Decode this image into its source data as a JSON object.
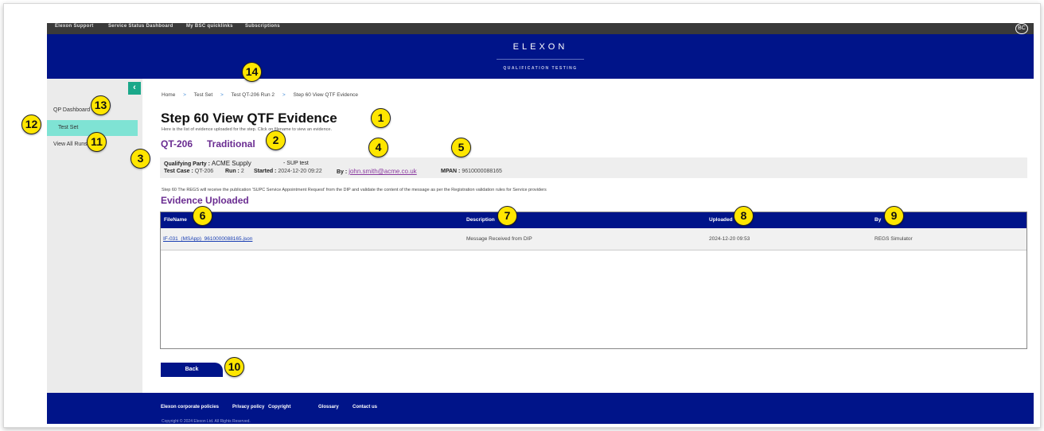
{
  "util_nav": [
    "Elexon Support",
    "Service Status Dashboard",
    "My BSC quicklinks",
    "Subscriptions"
  ],
  "user_initials": "BC",
  "header": {
    "logo": "ELEXON",
    "subtitle": "QUALIFICATION TESTING"
  },
  "sidebar": {
    "toggle_icon": "chevron-left-icon",
    "items": [
      {
        "label": "QP Dashboard",
        "active": false
      },
      {
        "label": "Test Set",
        "active": true
      },
      {
        "label": "View All Runs",
        "active": false
      }
    ]
  },
  "breadcrumb": [
    "Home",
    "Test Set",
    "Test QT-206 Run 2",
    "Step 60 View QTF Evidence"
  ],
  "page": {
    "title": "Step 60 View QTF Evidence",
    "description": "Here is the list of evidence uploaded for the step. Click on filename to view an evidence.",
    "qt_code": "QT-206",
    "qt_type": "Traditional"
  },
  "info": {
    "qualifying_party_label": "Qualifying Party :",
    "qualifying_party": "ACME Supply",
    "sup_label": "- SUP test",
    "test_case_label": "Test Case :",
    "test_case": "QT-206",
    "run_label": "Run :",
    "run": "2",
    "started_label": "Started :",
    "started": "2024-12-20 09:22",
    "by_label": "By :",
    "by": "john.smith@acme.co.uk",
    "mpan_label": "MPAN :",
    "mpan": "9610000088165"
  },
  "step_description": "Step 60 The REGS will receive the publication 'SUPC Service Appointment Request' from the DIP and validate the content of the message as per the Registration validation rules for Service providers",
  "evidence": {
    "title": "Evidence Uploaded",
    "columns": [
      "FileName",
      "Description",
      "Uploaded",
      "By"
    ],
    "rows": [
      [
        "IF-031_(MSApp)_9610000088165.json",
        "Message Received from DIP",
        "2024-12-20 09:53",
        "REGS Simulator"
      ]
    ]
  },
  "back_label": "Back",
  "footer": {
    "links": [
      "Elexon corporate policies",
      "Privacy policy",
      "Copyright",
      "Glossary",
      "Contact us"
    ],
    "copyright": "Copyright © 2024 Elexon Ltd. All Rights Reserved."
  },
  "callouts": [
    "1",
    "2",
    "3",
    "4",
    "5",
    "6",
    "7",
    "8",
    "9",
    "10",
    "11",
    "12",
    "13",
    "14"
  ],
  "colors": {
    "brand_navy": "#001489",
    "accent_purple": "#6a2c91",
    "sidebar_active": "#7fe3d4",
    "toggle_green": "#1aa88a",
    "callout_yellow": "#ffe600"
  }
}
